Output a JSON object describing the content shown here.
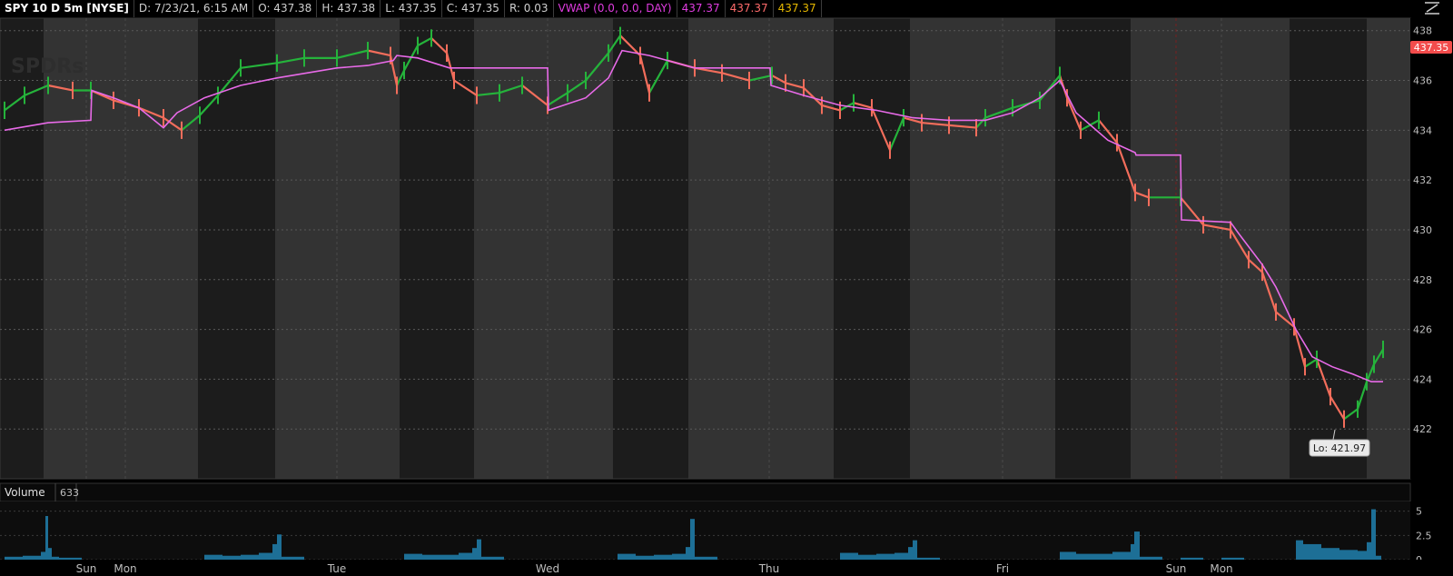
{
  "header": {
    "symbol": "SPY 10 D 5m [NYSE]",
    "date": "D: 7/23/21, 6:15 AM",
    "open": "O: 437.38",
    "high": "H: 437.38",
    "low": "L: 437.35",
    "close": "C: 437.35",
    "range": "R: 0.03",
    "vwap_label": "VWAP (0.0, 0.0, DAY)",
    "vwap_value": "437.37",
    "upper_band": "437.37",
    "lower_band": "437.37"
  },
  "watermark": "SPDRs",
  "last_price_tag": "437.35",
  "low_callout": "Lo: 421.97",
  "volume_panel": {
    "label": "Volume",
    "value": "633"
  },
  "colors": {
    "up": "#25b33b",
    "down": "#f26d5b",
    "vwap": "#e86ae8",
    "volume": "#1d6f96",
    "last_tag": "#f24c4c"
  },
  "chart_data": [
    {
      "type": "line",
      "title": "SPY 10 D 5m [NYSE]",
      "x_axis_labels": [
        "Sun",
        "Mon",
        "Tue",
        "Wed",
        "Thu",
        "Fri",
        "Sun",
        "Mon"
      ],
      "ylim": [
        420,
        438.5
      ],
      "yticks": [
        438,
        436,
        434,
        432,
        430,
        428,
        426,
        424,
        422
      ],
      "grid": true,
      "series": [
        {
          "name": "Price",
          "x": [
            0,
            22,
            48,
            75,
            95,
            120,
            148,
            175,
            195,
            215,
            235,
            260,
            300,
            330,
            366,
            400,
            425,
            432,
            440,
            455,
            470,
            487,
            495,
            520,
            545,
            570,
            598,
            620,
            640,
            665,
            678,
            700,
            710,
            730,
            760,
            790,
            820,
            845,
            860,
            880,
            900,
            920,
            935,
            955,
            975,
            990,
            1010,
            1040,
            1070,
            1080,
            1110,
            1140,
            1162,
            1170,
            1185,
            1205,
            1225,
            1245,
            1260,
            1295,
            1320,
            1350,
            1370,
            1385,
            1400,
            1420,
            1432,
            1445,
            1460,
            1475,
            1490,
            1500,
            1508,
            1518
          ],
          "values": [
            434.8,
            435.4,
            435.8,
            435.6,
            435.6,
            435.2,
            434.9,
            434.5,
            434.0,
            434.6,
            435.4,
            436.5,
            436.7,
            436.9,
            436.9,
            437.2,
            437.0,
            435.8,
            436.4,
            437.4,
            437.7,
            437.1,
            436.0,
            435.4,
            435.5,
            435.8,
            435.0,
            435.5,
            436.0,
            437.1,
            437.8,
            437.0,
            435.5,
            436.8,
            436.5,
            436.3,
            436.0,
            436.2,
            435.9,
            435.7,
            435.0,
            434.8,
            435.1,
            434.9,
            433.2,
            434.5,
            434.3,
            434.2,
            434.1,
            434.5,
            434.9,
            435.2,
            436.2,
            435.3,
            434.0,
            434.4,
            433.5,
            431.5,
            431.3,
            431.3,
            430.2,
            430.0,
            428.8,
            428.3,
            426.7,
            426.1,
            424.5,
            424.8,
            423.3,
            422.4,
            422.8,
            423.9,
            424.6,
            425.2
          ]
        },
        {
          "name": "VWAP (0.0, 0.0, DAY)",
          "x": [
            0,
            48,
            95,
            96,
            120,
            148,
            175,
            190,
            220,
            260,
            300,
            366,
            400,
            428,
            432,
            455,
            490,
            520,
            598,
            599,
            640,
            665,
            680,
            710,
            760,
            843,
            844,
            880,
            920,
            960,
            1000,
            1040,
            1080,
            1110,
            1140,
            1162,
            1180,
            1215,
            1245,
            1246,
            1295,
            1296,
            1350,
            1360,
            1385,
            1400,
            1422,
            1440,
            1462,
            1485,
            1505,
            1518
          ],
          "values": [
            434.0,
            434.3,
            434.4,
            435.6,
            435.3,
            434.9,
            434.1,
            434.7,
            435.3,
            435.8,
            436.1,
            436.5,
            436.6,
            436.8,
            437.0,
            436.9,
            436.5,
            436.5,
            436.5,
            434.8,
            435.3,
            436.1,
            437.2,
            437.0,
            436.5,
            436.5,
            435.8,
            435.4,
            435.0,
            434.8,
            434.5,
            434.4,
            434.4,
            434.7,
            435.3,
            436.0,
            434.7,
            433.6,
            433.1,
            433.0,
            433.0,
            430.4,
            430.3,
            429.8,
            428.6,
            427.7,
            426.0,
            424.9,
            424.5,
            424.2,
            423.9,
            423.9
          ]
        }
      ]
    },
    {
      "type": "bar",
      "title": "Volume",
      "x_axis_labels": [
        "Sun",
        "Mon",
        "Tue",
        "Wed",
        "Thu",
        "Fri",
        "Sun",
        "Mon"
      ],
      "ylim": [
        0,
        6
      ],
      "yticks": [
        5,
        2.5,
        0
      ],
      "series": [
        {
          "name": "Volume",
          "x": [
            0,
            20,
            40,
            45,
            48,
            52,
            60,
            220,
            240,
            260,
            280,
            295,
            300,
            305,
            440,
            460,
            480,
            500,
            515,
            520,
            525,
            675,
            695,
            715,
            735,
            750,
            755,
            760,
            920,
            940,
            960,
            980,
            995,
            1000,
            1005,
            1162,
            1180,
            1200,
            1220,
            1240,
            1244,
            1250,
            1295,
            1340,
            1422,
            1430,
            1450,
            1470,
            1490,
            1500,
            1505,
            1510
          ],
          "values": [
            0.3,
            0.4,
            0.8,
            4.5,
            1.2,
            0.3,
            0.2,
            0.5,
            0.4,
            0.5,
            0.7,
            1.6,
            2.6,
            0.3,
            0.6,
            0.5,
            0.5,
            0.7,
            1.2,
            2.1,
            0.3,
            0.6,
            0.4,
            0.5,
            0.6,
            1.3,
            4.2,
            0.3,
            0.7,
            0.5,
            0.6,
            0.7,
            1.3,
            2.0,
            0.2,
            0.8,
            0.6,
            0.6,
            0.8,
            1.6,
            2.9,
            0.3,
            0.2,
            0.2,
            2.0,
            1.6,
            1.2,
            1.0,
            0.9,
            1.8,
            5.2,
            0.4
          ]
        }
      ]
    }
  ]
}
